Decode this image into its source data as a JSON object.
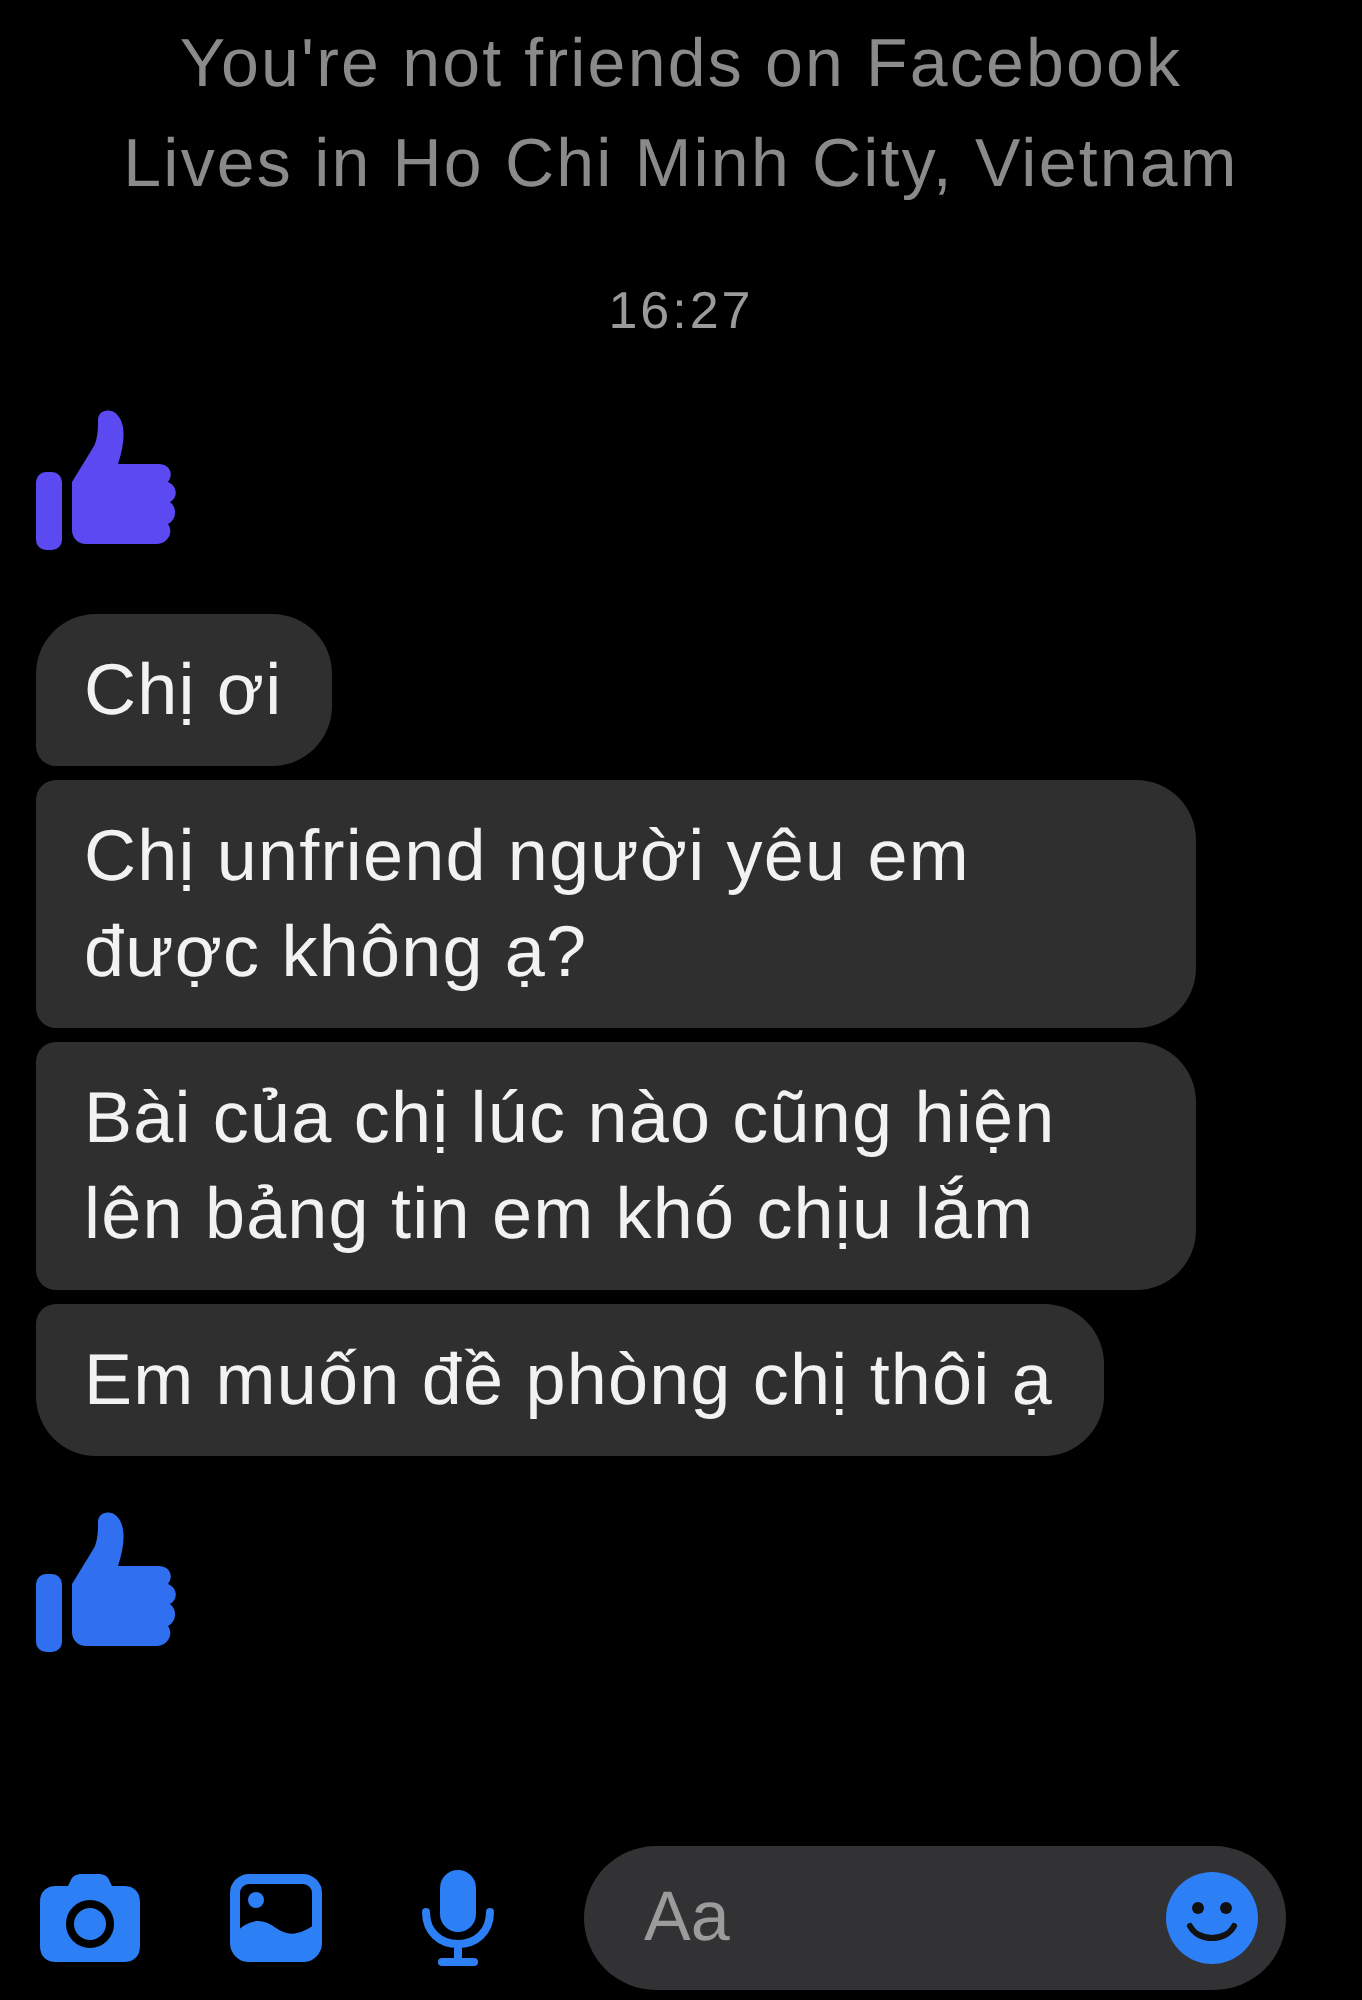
{
  "header": {
    "lines": [
      "You're not friends on Facebook",
      "Lives in Ho Chi Minh City, Vietnam"
    ]
  },
  "timestamp": "16:27",
  "messages": [
    {
      "kind": "like",
      "color": "#5b4af2"
    },
    {
      "kind": "text",
      "text": "Chị ơi"
    },
    {
      "kind": "text",
      "text": "Chị unfriend người yêu em được không ạ?"
    },
    {
      "kind": "text",
      "text": "Bài của chị lúc nào cũng hiện lên bảng tin em khó chịu lắm"
    },
    {
      "kind": "text",
      "text": "Em muốn đề phòng chị thôi ạ"
    },
    {
      "kind": "like",
      "color": "#2f6ff0"
    }
  ],
  "composer": {
    "placeholder": "Aa"
  }
}
